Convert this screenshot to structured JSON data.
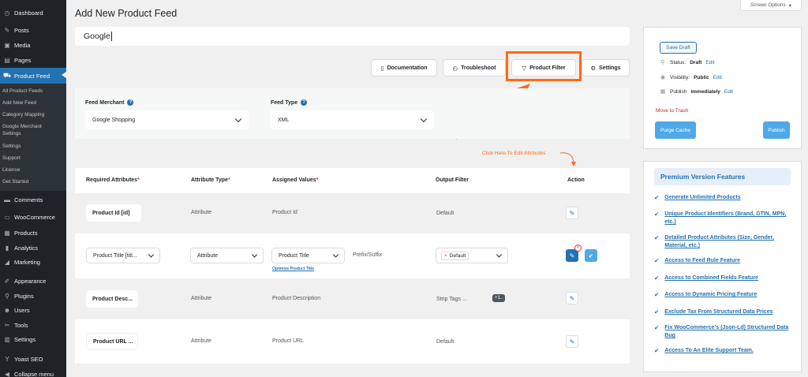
{
  "sidebar": {
    "items": [
      {
        "label": "Dashboard",
        "icon": "dashboard-icon",
        "glyph": "◷"
      },
      {
        "label": "Posts",
        "icon": "pin-icon",
        "glyph": "✎"
      },
      {
        "label": "Media",
        "icon": "media-icon",
        "glyph": "▣"
      },
      {
        "label": "Pages",
        "icon": "pages-icon",
        "glyph": "▤"
      },
      {
        "label": "Product Feed",
        "icon": "cart-icon",
        "glyph": "⛟"
      },
      {
        "label": "Comments",
        "icon": "comments-icon",
        "glyph": "▬"
      },
      {
        "label": "WooCommerce",
        "icon": "woocommerce-icon",
        "glyph": "▭"
      },
      {
        "label": "Products",
        "icon": "products-icon",
        "glyph": "▦"
      },
      {
        "label": "Analytics",
        "icon": "analytics-icon",
        "glyph": "▮"
      },
      {
        "label": "Marketing",
        "icon": "megaphone-icon",
        "glyph": "◢"
      },
      {
        "label": "Appearance",
        "icon": "brush-icon",
        "glyph": "✐"
      },
      {
        "label": "Plugins",
        "icon": "plugin-icon",
        "glyph": "⚲"
      },
      {
        "label": "Users",
        "icon": "users-icon",
        "glyph": "☻"
      },
      {
        "label": "Tools",
        "icon": "wrench-icon",
        "glyph": "✂"
      },
      {
        "label": "Settings",
        "icon": "settings-icon",
        "glyph": "▥"
      },
      {
        "label": "Yoast SEO",
        "icon": "yoast-icon",
        "glyph": "Y"
      },
      {
        "label": "Collapse menu",
        "icon": "collapse-icon",
        "glyph": "◀"
      }
    ],
    "submenu": [
      "All Product Feeds",
      "Add New Feed",
      "Category Mapping",
      "Google Merchant",
      "Settings",
      "Settings",
      "Support",
      "License",
      "Get Started"
    ]
  },
  "header": {
    "title": "Add New Product Feed",
    "screen_options": "Screen Options",
    "feed_name": "Google"
  },
  "toolbar": {
    "documentation": "Documentation",
    "troubleshoot": "Troubleshoot",
    "product_filter": "Product Filter",
    "settings": "Settings"
  },
  "merchant": {
    "merchant_label": "Feed Merchant",
    "merchant_value": "Google Shopping",
    "type_label": "Feed Type",
    "type_value": "XML"
  },
  "hint": "Click Here To Edit Attributes",
  "table": {
    "headers": {
      "required": "Required Attributes",
      "type": "Attribute Type",
      "assigned": "Assigned Values",
      "output": "Output Filter",
      "action": "Action"
    },
    "rows": [
      {
        "required": "Product Id [id]",
        "type": "Attribute",
        "assigned": "Product Id",
        "output": "Default"
      },
      {
        "required": "Product Title [titl...",
        "type": "Attribute",
        "assigned": "Product Title",
        "prefix": "Prefix/Suffix",
        "output": "Default",
        "optimize": "Optimize Product Title"
      },
      {
        "required": "Product Desc...",
        "type": "Attribute",
        "assigned": "Product Description",
        "output": "Strip Tags ...",
        "extra": "+1.."
      },
      {
        "required": "Product URL ...",
        "type": "Attribute",
        "assigned": "Product URL",
        "output": "Default"
      }
    ]
  },
  "publish": {
    "save_draft": "Save Draft",
    "status_label": "Status:",
    "status_value": "Draft",
    "visibility_label": "Visibility:",
    "visibility_value": "Public",
    "publish_label": "Publish",
    "publish_value": "immediately",
    "edit": "Edit",
    "trash": "Move to Trash",
    "purge": "Purge Cache",
    "publish_btn": "Publish"
  },
  "premium": {
    "title": "Premium Version Features",
    "features": [
      "Generate Unlimited Products",
      "Unique Product Identifiers (Brand, GTIN, MPN, etc.)",
      "Detailed Product Attributes (Size, Gender, Material, etc.)",
      "Access to Feed Rule Feature",
      "Access to Combined Fields Feature",
      "Access to Dynamic Pricing Feature",
      "Exclude Tax From Structured Data Prices",
      "Fix WooCommerce's (Json-Ld) Structured Data Bug",
      "Access To An Elite Support Team."
    ]
  },
  "colors": {
    "accent": "#2271b1",
    "highlight": "#ff6a13",
    "sidebar": "#1d2327"
  }
}
